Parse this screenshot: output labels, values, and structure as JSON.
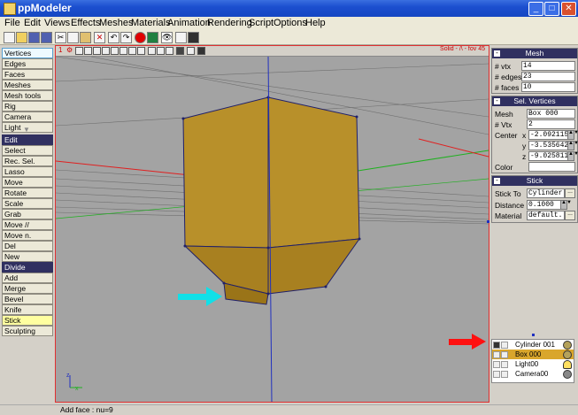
{
  "window": {
    "title": "ppModeler"
  },
  "menu": [
    "File",
    "Edit",
    "Views",
    "Effects",
    "Meshes",
    "Materials",
    "Animation",
    "Rendering",
    "Script",
    "Options",
    "Help"
  ],
  "toolbar_icons": [
    "new-icon",
    "open-icon",
    "save-icon",
    "save-as-icon",
    "cut-icon",
    "copy-icon",
    "paste-icon",
    "delete-icon",
    "undo-icon",
    "redo-icon",
    "record-icon",
    "material-icon",
    "eye-icon",
    "grid-icon",
    "layout-icon"
  ],
  "left_panel": {
    "mode_items": [
      "Vertices",
      "Edges",
      "Faces",
      "Meshes",
      "Mesh tools",
      "Rig",
      "Camera",
      "Light"
    ],
    "edit_header": "Edit",
    "edit_items": [
      "Select",
      "Rec. Sel.",
      "Lasso",
      "Move",
      "Rotate",
      "Scale",
      "Grab",
      "Move //",
      "Move n.",
      "Del",
      "New"
    ],
    "divide_header": "Divide",
    "divide_items": [
      "Add",
      "Merge",
      "Bevel",
      "Knife",
      "Stick",
      "Sculpting"
    ]
  },
  "viewport": {
    "number": "1",
    "mode_label": "Solid - /\\ - fov 45",
    "axis_x": "x",
    "axis_z": "z"
  },
  "mesh_box": {
    "title": "Mesh",
    "vtx_label": "# vtx",
    "vtx_value": "14",
    "edges_label": "# edges",
    "edges_value": "23",
    "faces_label": "# faces",
    "faces_value": "10"
  },
  "sel_vertices_box": {
    "title": "Sel. Vertices",
    "mesh_label": "Mesh",
    "mesh_value": "Box 000",
    "vtx_label": "# Vtx",
    "vtx_value": "2",
    "center_label": "Center",
    "x_label": "x",
    "x_value": "-2.092115",
    "y_label": "y",
    "y_value": "-3.535642",
    "z_label": "z",
    "z_value": "-9.025811",
    "color_label": "Color"
  },
  "stick_box": {
    "title": "Stick",
    "stick_to_label": "Stick To",
    "stick_to_value": "Cylinder",
    "distance_label": "Distance",
    "distance_value": "0.1000",
    "material_label": "Material",
    "material_value": "default."
  },
  "outliner": {
    "items": [
      {
        "name": "Cylinder 001"
      },
      {
        "name": "Box 000"
      },
      {
        "name": "Light00"
      },
      {
        "name": "Camera00"
      }
    ]
  },
  "status": {
    "text": "Add face :  nu=9"
  }
}
